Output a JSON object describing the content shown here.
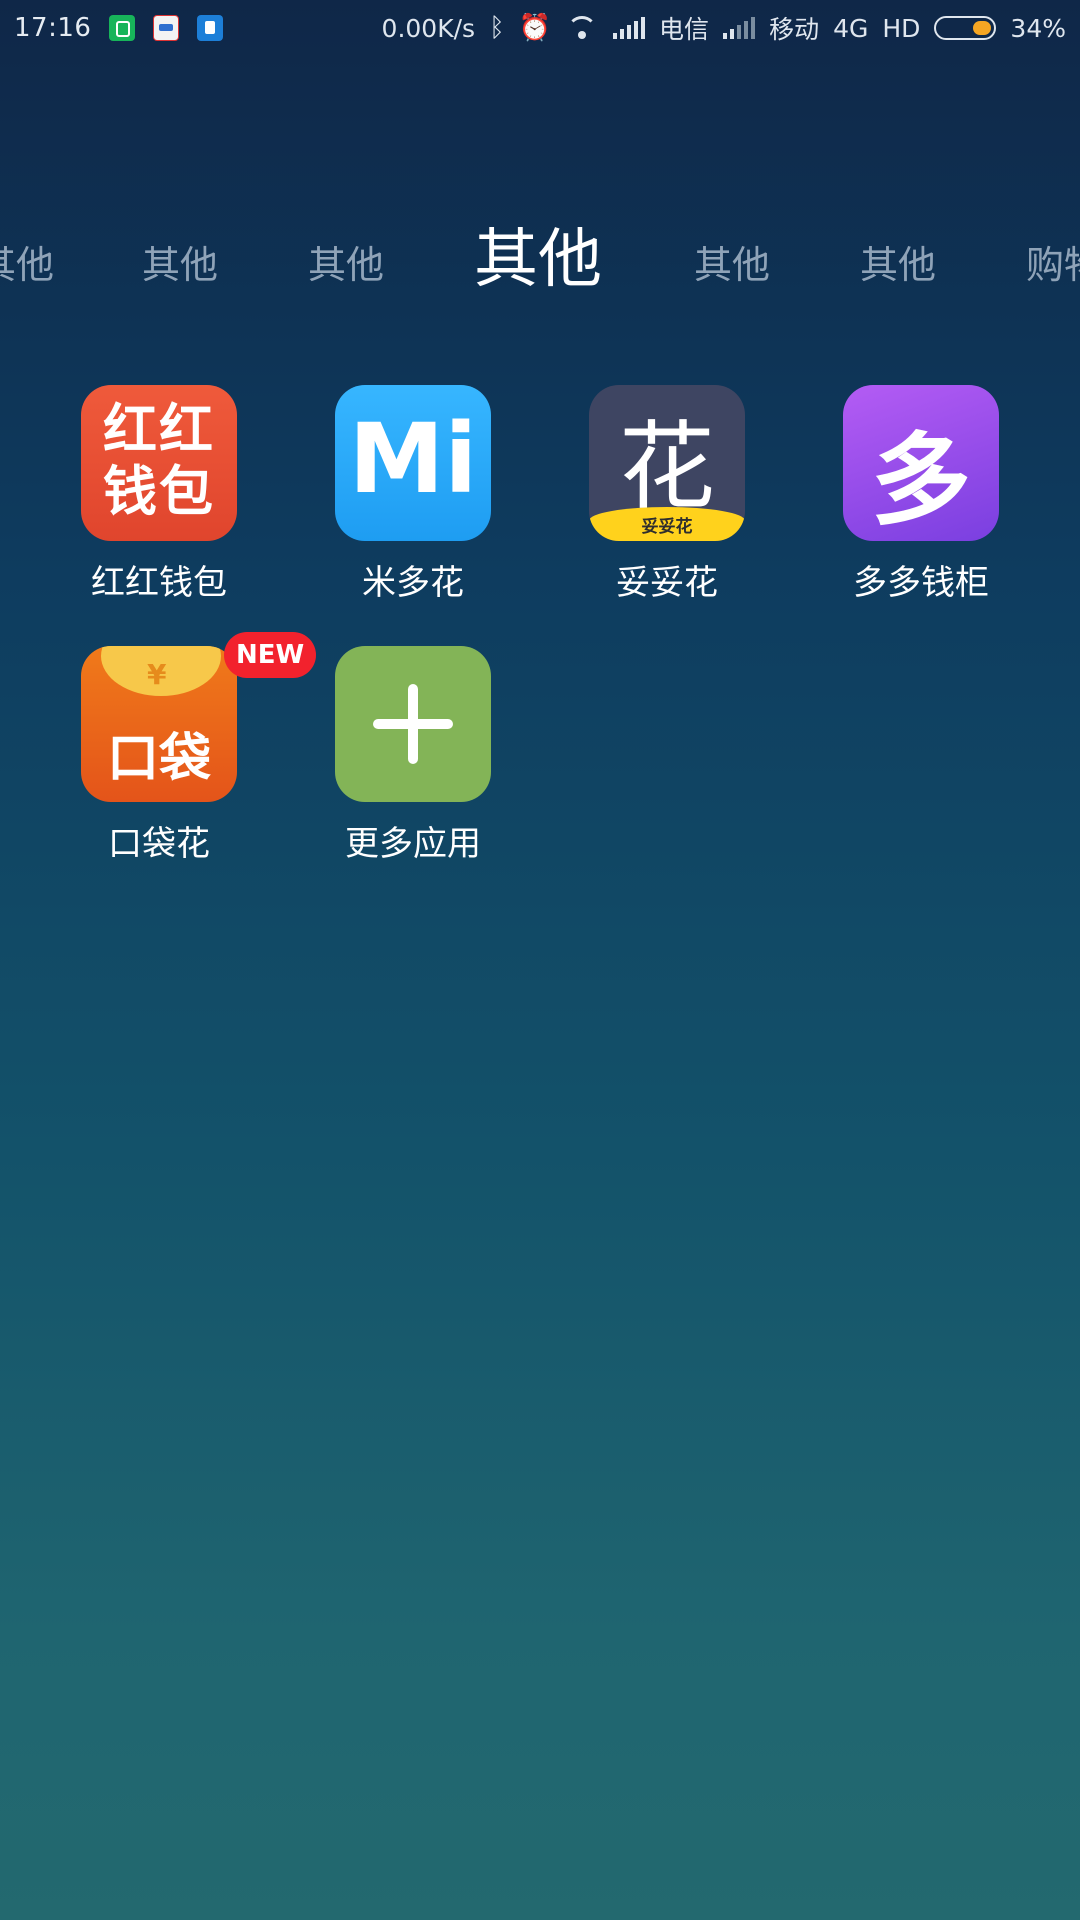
{
  "status_bar": {
    "time": "17:16",
    "speed": "0.00K/s",
    "carrier1": "电信",
    "carrier2": "移动",
    "network": "4G",
    "hd": "HD",
    "battery_pct": "34%",
    "battery_level": 0.34,
    "icons": [
      "phone-notification-icon",
      "app-notification-icon",
      "file-notification-icon",
      "bluetooth-icon",
      "alarm-icon",
      "wifi-icon",
      "signal-icon",
      "battery-icon"
    ]
  },
  "tabs": [
    {
      "label": "其他",
      "active": false
    },
    {
      "label": "其他",
      "active": false
    },
    {
      "label": "其他",
      "active": false
    },
    {
      "label": "其他",
      "active": true
    },
    {
      "label": "其他",
      "active": false
    },
    {
      "label": "其他",
      "active": false
    },
    {
      "label": "购物",
      "active": false
    }
  ],
  "apps": [
    {
      "label": "红红钱包",
      "icon_text": "红红\n钱包",
      "icon": "honghong-wallet-icon",
      "color": "#e8502f"
    },
    {
      "label": "米多花",
      "icon_text": "Mi",
      "icon": "miduohua-icon",
      "color": "#2aa8fb"
    },
    {
      "label": "妥妥花",
      "icon_text": "花",
      "icon_band_text": "妥妥花",
      "icon": "tuotuohua-icon",
      "color": "#3e4562"
    },
    {
      "label": "多多钱柜",
      "icon_text": "多",
      "icon": "duoduo-qiangui-icon",
      "color": "#9a4ff0"
    },
    {
      "label": "口袋花",
      "icon_text": "口袋",
      "icon_coin": "¥",
      "badge": "NEW",
      "icon": "koudaihua-icon",
      "color": "#ec6a1a"
    },
    {
      "label": "更多应用",
      "icon": "plus-icon",
      "color": "#83b457"
    }
  ]
}
